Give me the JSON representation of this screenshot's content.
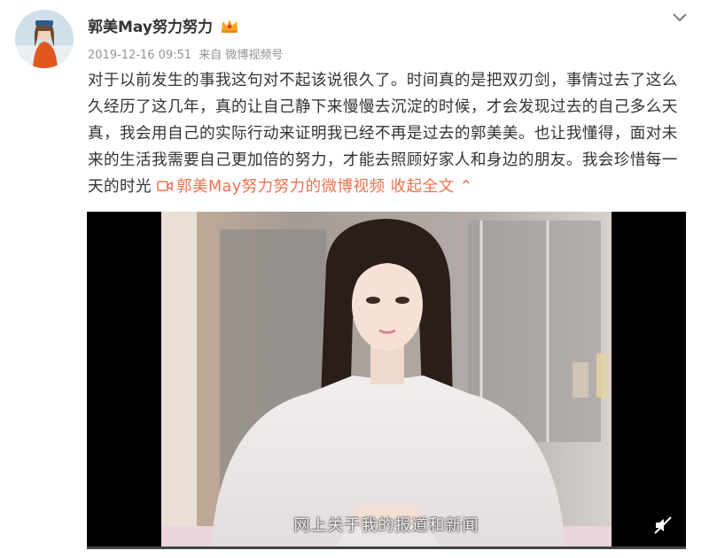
{
  "post": {
    "username": "郭美May努力努力",
    "timestamp": "2019-12-16 09:51",
    "source_prefix": "来自",
    "source": "微博视频号",
    "text": "对于以前发生的事我这句对不起该说很久了。时间真的是把双刃剑，事情过去了这么久经历了这几年，真的让自己静下来慢慢去沉淀的时候，才会发现过去的自己多么天真，我会用自己的实际行动来证明我已经不再是过去的郭美美。也让我懂得，面对未来的生活我需要自己更加倍的努力，才能去照顾好家人和身边的朋友。我会珍惜每一天的时光",
    "video_link_label": "郭美May努力努力的微博视频",
    "collapse_label": "收起全文",
    "collapse_icon_glyph": "⌃"
  },
  "video": {
    "subtitle": "网上关于我的报道和新闻",
    "progress": 0.0
  },
  "colors": {
    "link": "#eb7350",
    "meta": "#939393",
    "text": "#333333",
    "crown": "#f5a623"
  },
  "icons": {
    "verified": "crown-badge-icon",
    "menu": "chevron-down-icon",
    "video_link": "video-camera-icon",
    "mute": "speaker-muted-icon"
  }
}
